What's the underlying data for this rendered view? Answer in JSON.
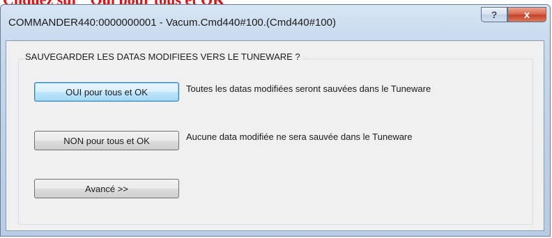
{
  "document": {
    "caption": "Cliquez sur \"Oui pour tous et OK\""
  },
  "dialog": {
    "title": "COMMANDER440:0000000001 - Vacum.Cmd440#100.(Cmd440#100)",
    "help_glyph": "?",
    "close_glyph": "x",
    "group_title": "SAUVEGARDER LES DATAS MODIFIEES VERS LE TUNEWARE ?",
    "options": [
      {
        "button": "OUI pour tous et OK",
        "description": "Toutes les datas modifiées seront sauvées dans le Tuneware",
        "is_default": true
      },
      {
        "button": "NON pour tous et OK",
        "description": "Aucune data modifiée ne sera sauvée dans le Tuneware",
        "is_default": false
      }
    ],
    "advanced_button": "Avancé >>"
  },
  "colors": {
    "caption": "#e01010",
    "close_button": "#c4432a",
    "default_button_border": "#3c7fb1",
    "client_background": "#f0f0f0"
  },
  "icons": {
    "help": "help-icon",
    "close": "close-icon"
  }
}
